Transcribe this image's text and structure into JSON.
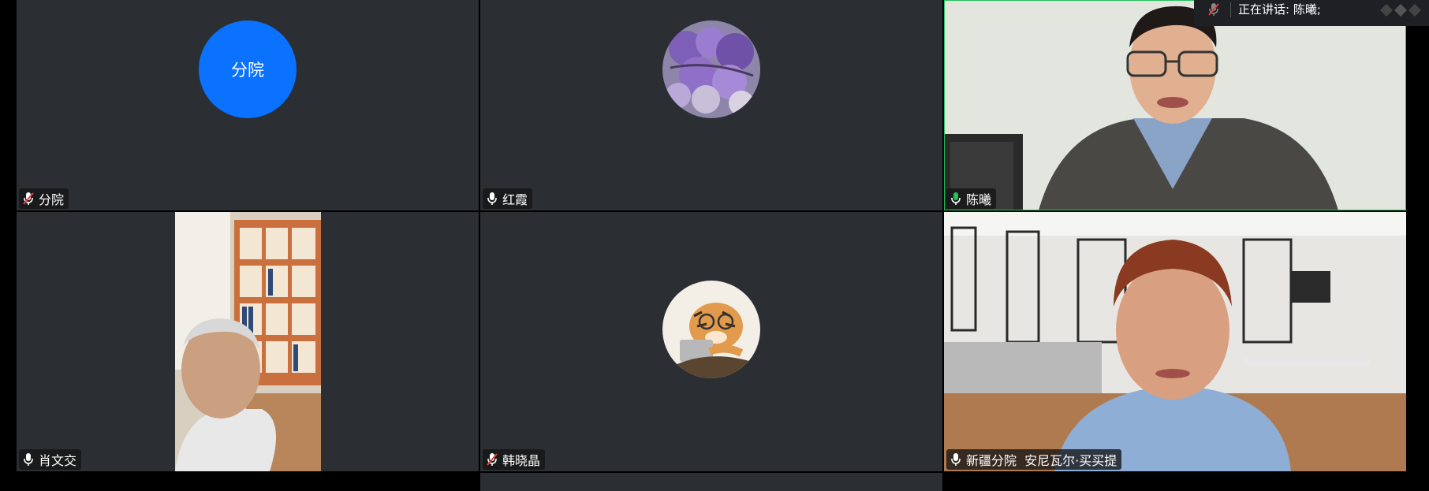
{
  "status_bar": {
    "speaking_label": "正在讲话: 陈曦;"
  },
  "tiles": [
    {
      "name": "分院",
      "avatar_text": "分院",
      "mic": "muted"
    },
    {
      "name": "红霞",
      "mic": "on"
    },
    {
      "name": "陈曦",
      "mic": "speaking"
    },
    {
      "name": "肖文交",
      "mic": "on"
    },
    {
      "name": "韩晓晶",
      "mic": "muted"
    },
    {
      "name": "新疆分院  安尼瓦尔·买买提",
      "mic": "on"
    }
  ],
  "colors": {
    "tile_bg": "#2b2e33",
    "avatar_blue": "#0a72ff",
    "speaking_green": "#23c15a",
    "muted_red": "#e0403c"
  }
}
